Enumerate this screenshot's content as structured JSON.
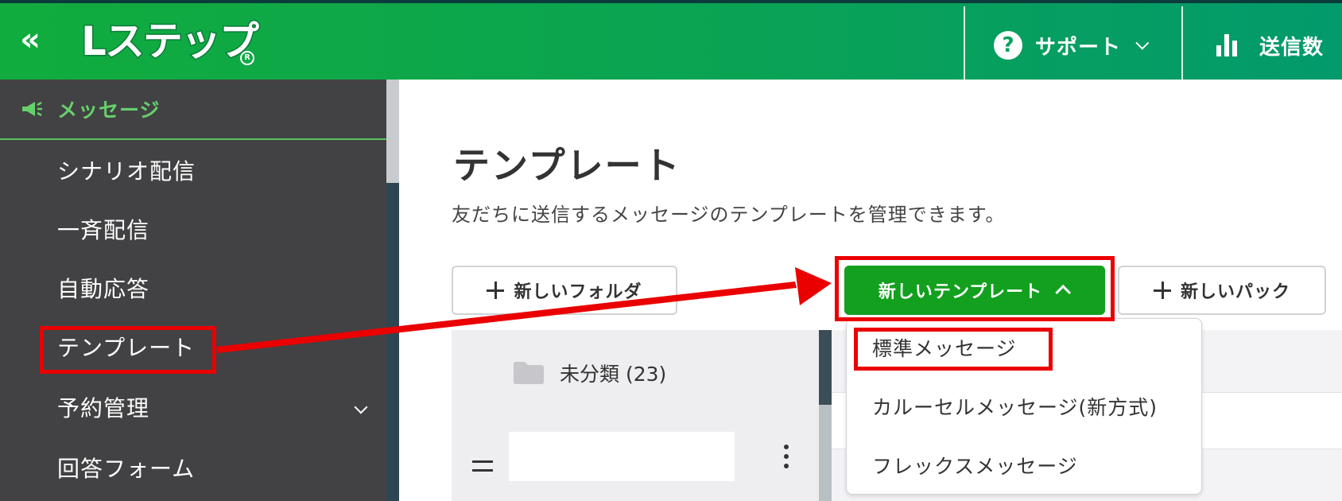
{
  "header": {
    "collapse_icon": "double-chevron-left-icon",
    "logo_text": "Lステップ",
    "logo_reg": "R",
    "support_icon": "question-circle-icon",
    "support_label": "サポート",
    "sendcount_icon": "bar-chart-icon",
    "sendcount_label": "送信数"
  },
  "sidebar": {
    "section": {
      "icon": "megaphone-icon",
      "label": "メッセージ"
    },
    "items": [
      {
        "label": "シナリオ配信"
      },
      {
        "label": "一斉配信"
      },
      {
        "label": "自動応答"
      },
      {
        "label": "テンプレート",
        "active": true
      },
      {
        "label": "予約管理",
        "has_submenu": true
      },
      {
        "label": "回答フォーム"
      }
    ]
  },
  "main": {
    "title": "テンプレート",
    "description": "友だちに送信するメッセージのテンプレートを管理できます。",
    "buttons": {
      "new_folder": "新しいフォルダ",
      "new_template": "新しいテンプレート",
      "new_pack": "新しいパック"
    },
    "folders": [
      {
        "label": "未分類 (23)",
        "icon": "folder-icon"
      }
    ],
    "folder_input_value": ""
  },
  "dropdown": {
    "items": [
      {
        "label": "標準メッセージ"
      },
      {
        "label": "カルーセルメッセージ(新方式)"
      },
      {
        "label": "フレックスメッセージ"
      }
    ]
  },
  "colors": {
    "header_green": "#0aa354",
    "sidebar_bg": "#424244",
    "accent_green": "#66d16b",
    "button_green": "#12a01e",
    "annotation_red": "#ea0000"
  }
}
